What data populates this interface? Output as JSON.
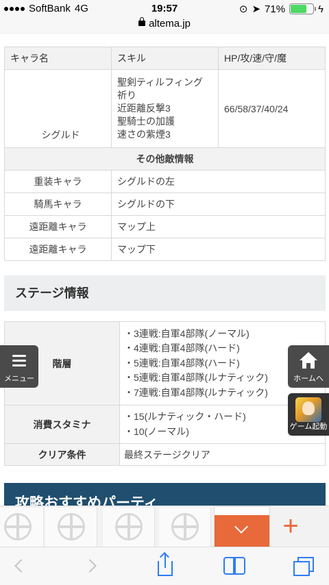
{
  "status": {
    "carrier": "SoftBank",
    "network": "4G",
    "time": "19:57",
    "battery": "71%",
    "battery_level": 0.71,
    "url": "altema.jp"
  },
  "enemy_table": {
    "headers": [
      "キャラ名",
      "スキル",
      "HP/攻/速/守/魔"
    ],
    "boss": {
      "name": "シグルド",
      "skills": [
        "聖剣ティルフィング",
        "祈り",
        "近距離反撃3",
        "聖騎士の加護",
        "速さの紫煙3"
      ],
      "stats": "66/58/37/40/24"
    },
    "other_header": "その他敵情報",
    "others": [
      {
        "type": "重装キャラ",
        "location": "シグルドの左"
      },
      {
        "type": "騎馬キャラ",
        "location": "シグルドの下"
      },
      {
        "type": "遠距離キャラ",
        "location": "マップ上"
      },
      {
        "type": "遠距離キャラ",
        "location": "マップ下"
      }
    ]
  },
  "stage_section": {
    "title": "ステージ情報",
    "floors_label": "階層",
    "floors": [
      "・3連戦:自軍4部隊(ノーマル)",
      "・4連戦:自軍4部隊(ハード)",
      "・5連戦:自軍4部隊(ハード)",
      "・5連戦:自軍4部隊(ルナティック)",
      "・7連戦:自軍4部隊(ルナティック)"
    ],
    "stamina_label": "消費スタミナ",
    "stamina": [
      "・15(ルナティック・ハード)",
      "・10(ノーマル)"
    ],
    "clear_label": "クリア条件",
    "clear": "最終ステージクリア"
  },
  "party_bar": "攻略おすすめパーティ",
  "fabs": {
    "menu": "メニュー",
    "home": "ホームへ",
    "game": "ゲーム起動"
  },
  "colors": {
    "link": "#2a6fb8",
    "party_bar": "#1f4e6e",
    "accent": "#e8693a",
    "toolbar_icon": "#2e7cf6"
  }
}
